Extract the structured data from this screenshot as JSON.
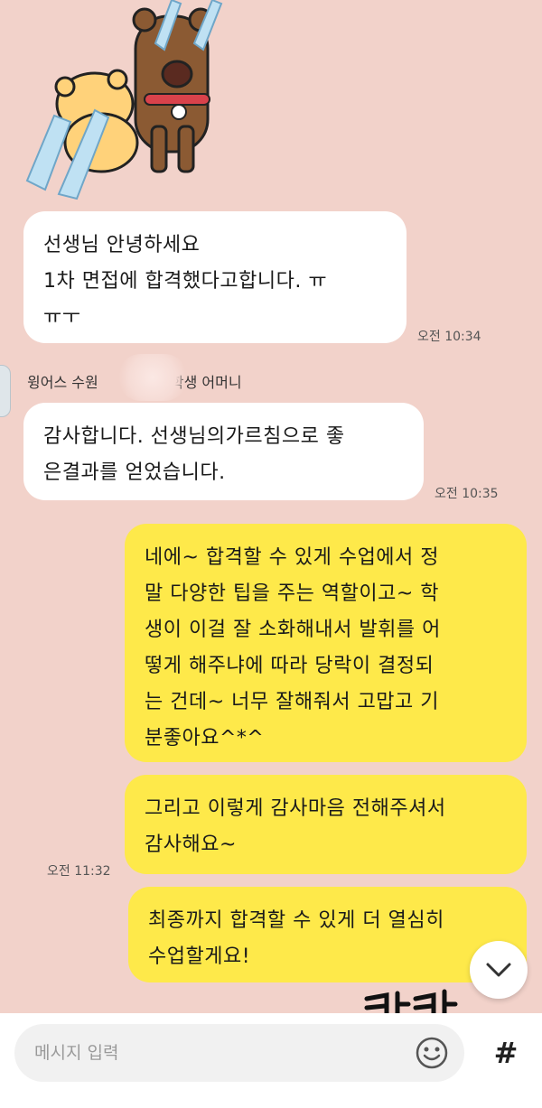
{
  "messages": [
    {
      "text": "선생님 안녕하세요\n1차 면접에 합격했다고합니다. ㅠ\nㅠㅜ",
      "time": "오전 10:34"
    },
    {
      "text": "감사합니다. 선생님의가르침으로 좋\n은결과를 얻었습니다.",
      "time": "오전 10:35"
    },
    {
      "text": "네에~ 합격할 수 있게 수업에서 정\n말 다양한 팁을 주는 역할이고~ 학\n생이 이걸 잘 소화해내서 발휘를 어\n떻게 해주냐에 따라 당락이 결정되\n는 건데~ 너무 잘해줘서 고맙고 기\n분좋아요^*^"
    },
    {
      "text": "그리고 이렇게 감사마음 전해주셔서\n감사해요~",
      "time": "오전 11:32"
    },
    {
      "text": "최종까지 합격할 수 있게 더 열심히\n수업할게요!"
    }
  ],
  "sender": {
    "prefix": "윙어스 수원",
    "suffix": "학생 어머니"
  },
  "input": {
    "placeholder": "메시지 입력"
  },
  "icons": {
    "scroll_down": "chevron-down-icon",
    "emoji": "emoji-icon",
    "hash": "#"
  },
  "colors": {
    "background": "#f2d2ca",
    "received": "#ffffff",
    "sent": "#fee94a"
  }
}
